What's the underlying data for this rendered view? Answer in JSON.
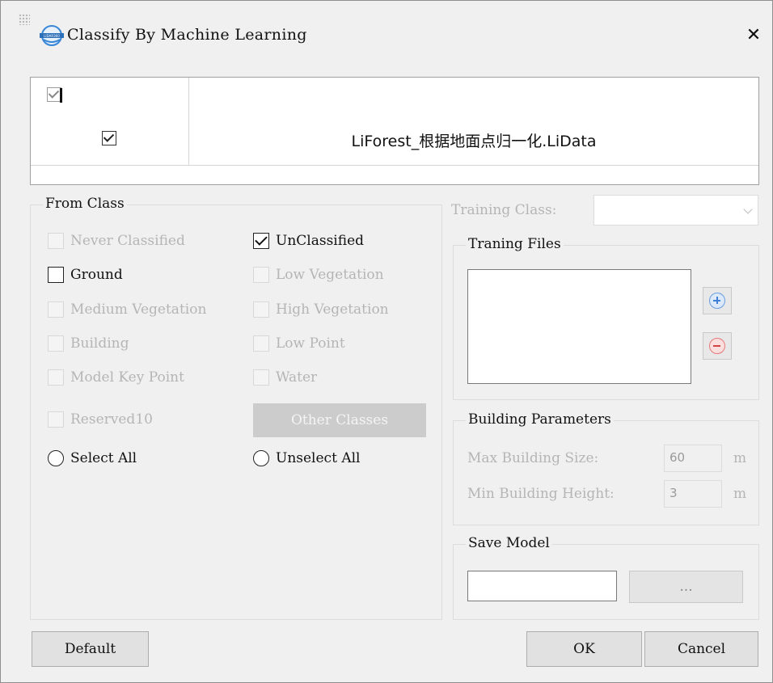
{
  "dialog": {
    "title": "Classify By Machine Learning",
    "close": "✕"
  },
  "files": {
    "name": "LiForest_根据地面点归一化.LiData"
  },
  "from_class": {
    "title": "From Class",
    "never_classified": "Never Classified",
    "unclassified": "UnClassified",
    "ground": "Ground",
    "low_vegetation": "Low Vegetation",
    "medium_vegetation": "Medium Vegetation",
    "high_vegetation": "High Vegetation",
    "building": "Building",
    "low_point": "Low Point",
    "model_key_point": "Model Key Point",
    "water": "Water",
    "reserved10": "Reserved10",
    "other_classes": "Other Classes",
    "select_all": "Select All",
    "unselect_all": "Unselect All"
  },
  "training": {
    "class_label": "Training Class:",
    "class_value": "",
    "files_title": "Traning Files"
  },
  "building": {
    "title": "Building Parameters",
    "max_size_label": "Max Building Size:",
    "max_size_value": "60",
    "min_height_label": "Min Building Height:",
    "min_height_value": "3",
    "unit": "m"
  },
  "save_model": {
    "title": "Save Model",
    "path": "",
    "browse_label": "..."
  },
  "footer": {
    "default_label": "Default",
    "ok_label": "OK",
    "cancel_label": "Cancel"
  },
  "icons": {
    "add": "add-file-icon",
    "remove": "remove-file-icon",
    "app": "app-logo-icon"
  }
}
